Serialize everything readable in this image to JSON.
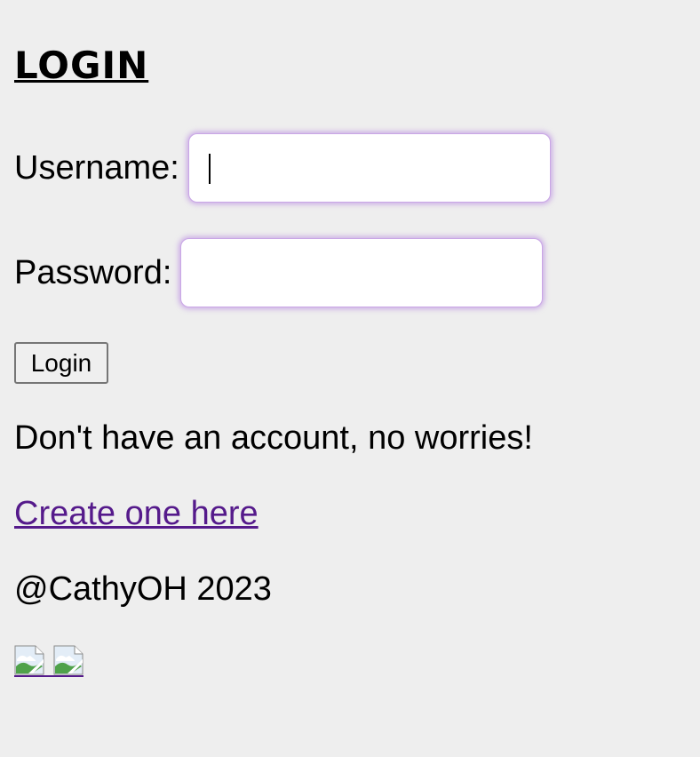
{
  "page": {
    "title": "LOGIN"
  },
  "form": {
    "username_label": "Username:",
    "username_value": "",
    "password_label": "Password:",
    "password_value": "",
    "submit_label": "Login"
  },
  "signup": {
    "prompt": "Don't have an account, no worries!",
    "link_text": "Create one here"
  },
  "footer": {
    "copyright": "@CathyOH 2023",
    "image_links": [
      {
        "icon": "broken-image-icon"
      },
      {
        "icon": "broken-image-icon"
      }
    ]
  },
  "colors": {
    "background": "#eeeeee",
    "link": "#551a8b",
    "input_focus_glow": "#b078e0"
  }
}
